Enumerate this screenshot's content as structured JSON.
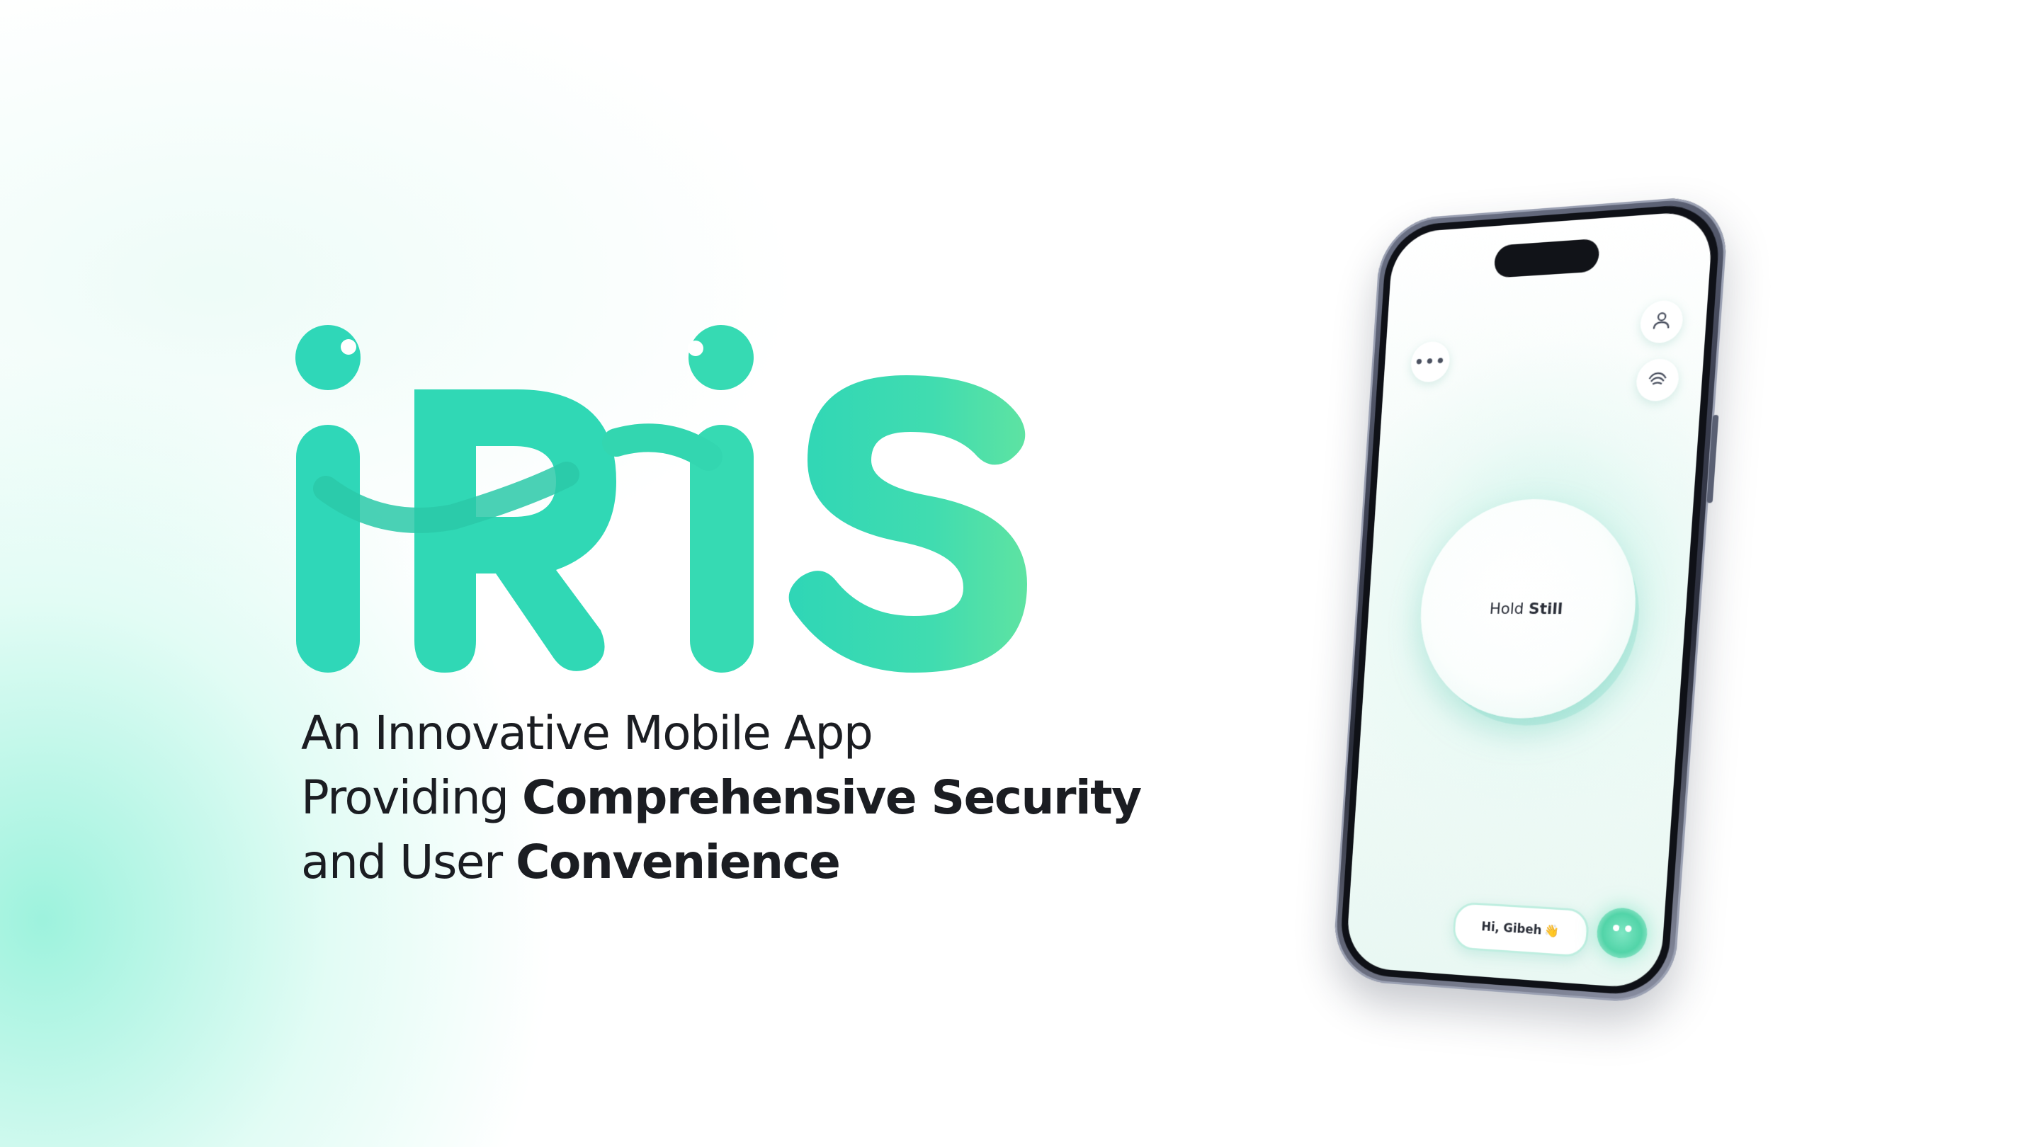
{
  "brand": {
    "name": "iRiS",
    "colors": {
      "primary": "#34d8b2",
      "secondary": "#55e0a8",
      "dark_text": "#1b1d22"
    }
  },
  "tagline": {
    "line1": "An Innovative Mobile App",
    "line2_light": "Providing ",
    "line2_bold": "Comprehensive Security",
    "line3_light": "and User ",
    "line3_bold": "Convenience"
  },
  "phone_screen": {
    "menu_icon": "•••",
    "profile_icon": "person-icon",
    "face_icon": "face-scan-icon",
    "scan_prompt_light": "Hold ",
    "scan_prompt_bold": "Still",
    "greeting": "Hi, Gibeh",
    "greeting_emoji": "👋",
    "mascot_icon": "mascot-face-icon"
  }
}
